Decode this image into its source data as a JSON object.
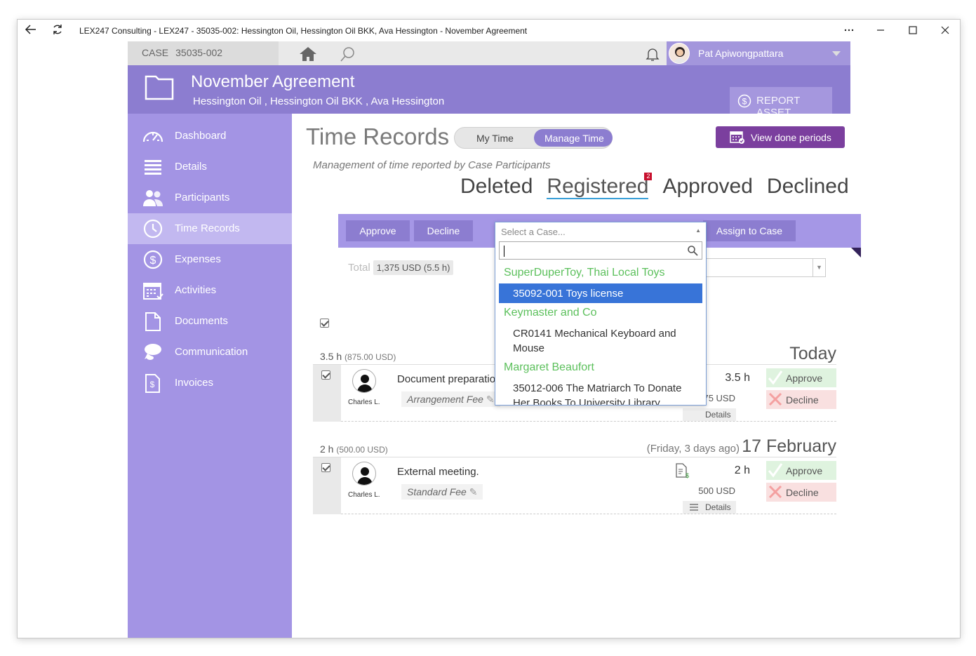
{
  "window": {
    "title": "LEX247 Consulting - LEX247 - 35035-002: Hessington Oil, Hessington Oil BKK, Ava Hessington - November Agreement"
  },
  "topbar": {
    "case_label": "CASE",
    "case_number": "35035-002",
    "user_name": "Pat Apiwongpattara"
  },
  "header": {
    "title": "November Agreement",
    "subtitle": "Hessington Oil ,  Hessington Oil BKK ,  Ava Hessington",
    "report_asset_label": "REPORT ASSET"
  },
  "sidebar": {
    "items": [
      {
        "label": "Dashboard",
        "icon": "dashboard-icon"
      },
      {
        "label": "Details",
        "icon": "details-icon"
      },
      {
        "label": "Participants",
        "icon": "participants-icon"
      },
      {
        "label": "Time Records",
        "icon": "clock-icon",
        "active": true
      },
      {
        "label": "Expenses",
        "icon": "dollar-icon"
      },
      {
        "label": "Activities",
        "icon": "calendar-icon"
      },
      {
        "label": "Documents",
        "icon": "document-icon"
      },
      {
        "label": "Communication",
        "icon": "chat-icon"
      },
      {
        "label": "Invoices",
        "icon": "invoice-icon"
      }
    ]
  },
  "main": {
    "page_title": "Time Records",
    "toggle": {
      "my_time": "My Time",
      "manage_time": "Manage Time"
    },
    "view_done_periods": "View done periods",
    "subtitle": "Management of time reported by Case Participants",
    "status_tabs": {
      "deleted": "Deleted",
      "registered": "Registered",
      "registered_badge": "2",
      "approved": "Approved",
      "declined": "Declined"
    },
    "actions": {
      "approve": "Approve",
      "decline": "Decline",
      "select_placeholder": "Select a Case...",
      "assign": "Assign to Case"
    },
    "total_label": "Total",
    "total_value": "1,375 USD (5.5 h)"
  },
  "groups": [
    {
      "hours": "3.5 h",
      "usd": "(875.00 USD)",
      "day_label": "Today",
      "record": {
        "person": "Charles L.",
        "description": "Document preparatio",
        "fee": "Arrangement Fee",
        "hours": "3.5 h",
        "usd": "75 USD",
        "details": "Details",
        "approve": "Approve",
        "decline": "Decline"
      }
    },
    {
      "hours": "2 h",
      "usd": "(500.00 USD)",
      "relative": "(Friday, 3 days ago)",
      "day_label": "17 February",
      "record": {
        "person": "Charles L.",
        "description": "External meeting.",
        "fee": "Standard Fee",
        "hours": "2 h",
        "usd": "500 USD",
        "details": "Details",
        "approve": "Approve",
        "decline": "Decline"
      }
    }
  ],
  "dropdown": {
    "placeholder": "Select a Case...",
    "groups": [
      {
        "name": "SuperDuperToy, Thai Local Toys",
        "options": [
          "35092-001 Toys license"
        ]
      },
      {
        "name": "Keymaster and Co",
        "options": [
          "CR0141 Mechanical Keyboard and Mouse"
        ]
      },
      {
        "name": "Margaret Beaufort",
        "options": [
          "35012-006 The Matriarch To Donate Her Books To University Library"
        ]
      }
    ]
  },
  "colors": {
    "sidebar": "#a394e4",
    "header": "#8c7dd0",
    "accent_purple": "#7b3f9e",
    "selected_option": "#3874d8",
    "group_green": "#5cc05c"
  }
}
